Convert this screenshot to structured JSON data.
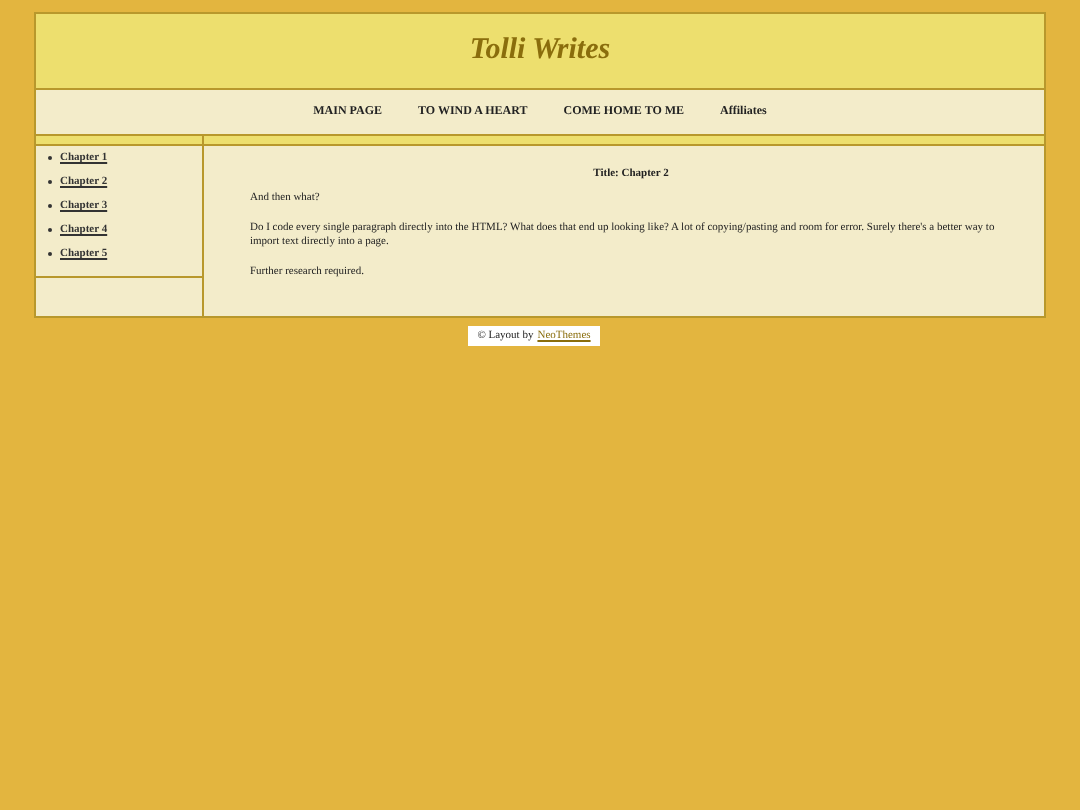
{
  "header": {
    "title": "Tolli Writes"
  },
  "nav": [
    "MAIN PAGE",
    "TO WIND A HEART",
    "COME HOME TO ME",
    "Affiliates"
  ],
  "sidebar": {
    "items": [
      "Chapter 1",
      "Chapter 2",
      "Chapter 3",
      "Chapter 4",
      "Chapter 5"
    ]
  },
  "content": {
    "title": "Title: Chapter 2",
    "paragraphs": [
      "And then what?",
      "Do I code every single paragraph directly into the HTML? What does that end up looking like? A lot of copying/pasting and room for error. Surely there's a better way to import text directly into a page.",
      "Further research required."
    ]
  },
  "footer": {
    "text": "© Layout by",
    "link": "NeoThemes"
  }
}
